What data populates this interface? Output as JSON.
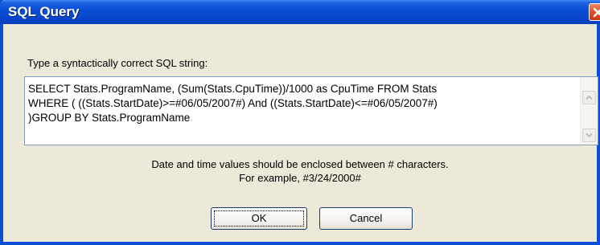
{
  "window": {
    "title": "SQL Query"
  },
  "prompt": {
    "label": "Type a syntactically correct SQL string:"
  },
  "sql": {
    "lines": [
      "SELECT Stats.ProgramName, (Sum(Stats.CpuTime))/1000 as CpuTime FROM Stats",
      "WHERE ( ((Stats.StartDate)>=#06/05/2007#) And ((Stats.StartDate)<=#06/05/2007#)",
      ")GROUP BY Stats.ProgramName"
    ]
  },
  "hint": {
    "line1": "Date and time values should be enclosed between # characters.",
    "line2": "For example, #3/24/2000#"
  },
  "buttons": {
    "ok": "OK",
    "cancel": "Cancel"
  },
  "icons": {
    "close": "close-icon",
    "scroll_up": "scroll-up-arrow-icon",
    "scroll_down": "scroll-down-arrow-icon"
  },
  "colors": {
    "titlebar": "#0a4fd6",
    "dialog_background": "#ece9d8",
    "close_button": "#e2522a"
  }
}
